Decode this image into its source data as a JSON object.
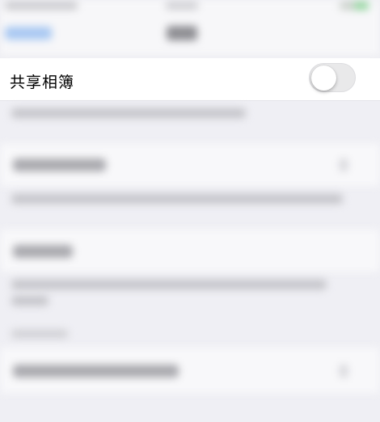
{
  "settings": {
    "shared_albums_label": "共享相簿",
    "shared_albums_enabled": false
  }
}
